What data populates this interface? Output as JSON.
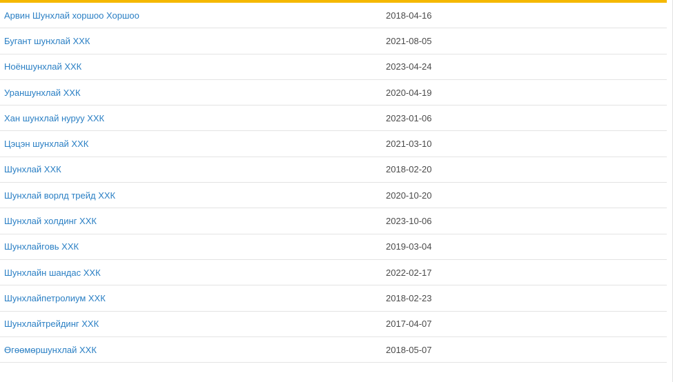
{
  "accent_color": "#f5b800",
  "link_color": "#2a7fc4",
  "rows": [
    {
      "name": "Арвин Шунхлай хоршоо Хоршоо",
      "date": "2018-04-16"
    },
    {
      "name": "Бугант шунхлай ХХК",
      "date": "2021-08-05"
    },
    {
      "name": "Ноёншунхлай ХХК",
      "date": "2023-04-24"
    },
    {
      "name": "Ураншунхлай ХХК",
      "date": "2020-04-19"
    },
    {
      "name": "Хан шунхлай нуруу ХХК",
      "date": "2023-01-06"
    },
    {
      "name": "Цэцэн шунхлай ХХК",
      "date": "2021-03-10"
    },
    {
      "name": "Шунхлай ХХК",
      "date": "2018-02-20"
    },
    {
      "name": "Шунхлай ворлд трейд ХХК",
      "date": "2020-10-20"
    },
    {
      "name": "Шунхлай холдинг ХХК",
      "date": "2023-10-06"
    },
    {
      "name": "Шунхлайговь ХХК",
      "date": "2019-03-04"
    },
    {
      "name": "Шунхлайн шандас ХХК",
      "date": "2022-02-17"
    },
    {
      "name": "Шунхлайпетролиум ХХК",
      "date": "2018-02-23"
    },
    {
      "name": "Шунхлайтрейдинг ХХК",
      "date": "2017-04-07"
    },
    {
      "name": "Өгөөмөршунхлай ХХК",
      "date": "2018-05-07"
    }
  ]
}
